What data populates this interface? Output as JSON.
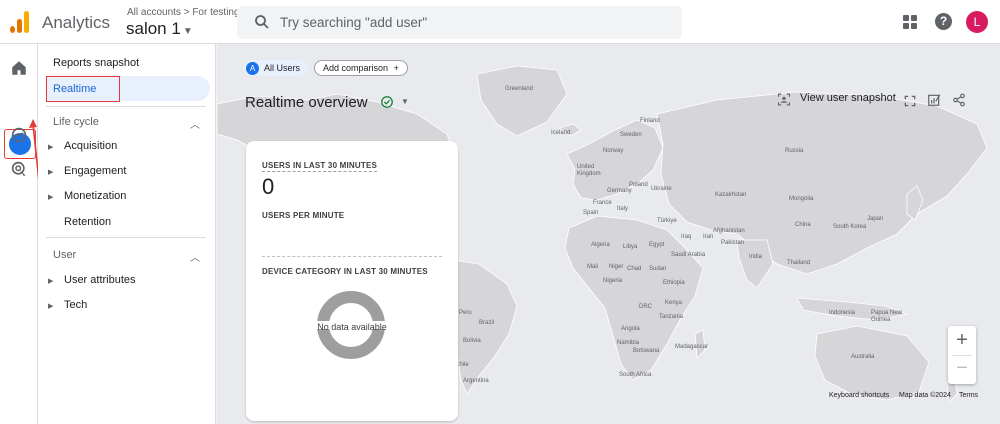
{
  "topbar": {
    "app_name": "Analytics",
    "account_crumb": "All accounts > For testing",
    "property_name": "salon 1",
    "search_placeholder": "Try searching \"add user\"",
    "avatar_letter": "L",
    "help_glyph": "?"
  },
  "colors": {
    "accent": "#1a73e8",
    "highlight": "#e53935",
    "avatar": "#d81b60"
  },
  "rail": {
    "icons": [
      "home-icon",
      "reports-icon",
      "explore-icon",
      "advertising-icon"
    ]
  },
  "nav": {
    "title": "Reports snapshot",
    "active": "Realtime",
    "sections": [
      {
        "label": "Life cycle",
        "items": [
          "Acquisition",
          "Engagement",
          "Monetization",
          "Retention"
        ]
      },
      {
        "label": "User",
        "items": [
          "User attributes",
          "Tech"
        ]
      }
    ]
  },
  "main": {
    "segment_badge": "A",
    "segment_chip": "All Users",
    "add_comparison": "Add comparison",
    "add_glyph": "+",
    "title": "Realtime overview",
    "snapshot_label": "View user snapshot",
    "card": {
      "users_label": "USERS IN LAST 30 MINUTES",
      "users_value": "0",
      "per_minute_label": "USERS PER MINUTE",
      "device_label": "DEVICE CATEGORY IN LAST 30 MINUTES",
      "no_data": "No data available"
    },
    "zoom_in": "+",
    "zoom_out": "−",
    "attribution": {
      "shortcuts": "Keyboard shortcuts",
      "map_data": "Map data ©2024",
      "terms": "Terms"
    },
    "map_labels": [
      "Greenland",
      "Iceland",
      "Finland",
      "Sweden",
      "Norway",
      "Russia",
      "United Kingdom",
      "Germany",
      "Poland",
      "Ukraine",
      "Kazakhstan",
      "France",
      "Italy",
      "Spain",
      "Türkiye",
      "Mongolia",
      "Japan",
      "South Korea",
      "China",
      "Iraq",
      "Iran",
      "Afghanistan",
      "Pakistan",
      "India",
      "Thailand",
      "Algeria",
      "Libya",
      "Egypt",
      "Saudi Arabia",
      "Mali",
      "Niger",
      "Sudan",
      "Chad",
      "Nigeria",
      "Ethiopia",
      "DRC",
      "Kenya",
      "Tanzania",
      "Angola",
      "Namibia",
      "Botswana",
      "Madagascar",
      "South Africa",
      "Indonesia",
      "Papua New Guinea",
      "Australia",
      "Brazil",
      "Peru",
      "Bolivia",
      "Argentina",
      "Chile"
    ]
  }
}
